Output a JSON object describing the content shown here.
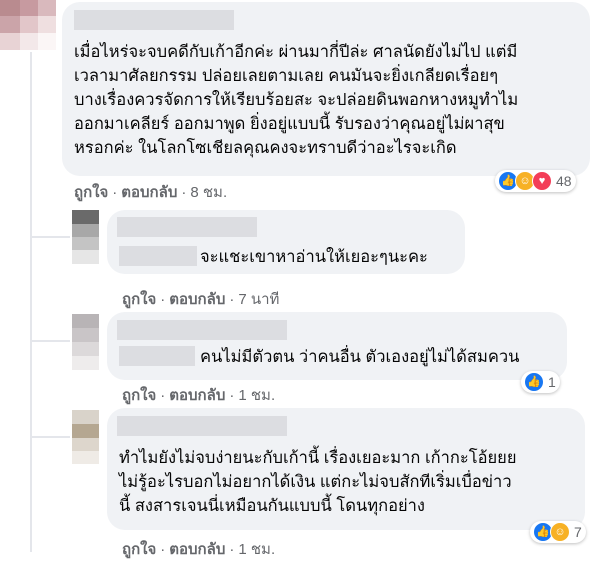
{
  "comments": [
    {
      "text": "เมื่อไหร่จะจบคดีกับเก้าอีกค่ะ ผ่านมากี่ปีล่ะ ศาลนัดยังไม่ไป แต่มี\nเวลามาศัลยกรรม ปล่อยเลยตามเลย คนมันจะยิ่งเกลียดเรื่อยๆ\nบางเรื่องควรจัดการให้เรียบร้อยสะ จะปล่อยดินพอกหางหมูทำไม\nออกมาเคลียร์ ออกมาพูด ยิ่งอยู่แบบนี้ รับรองว่าคุณอยู่ไม่ผาสุข\nหรอกค่ะ ในโลกโซเชียลคุณคงจะทราบดีว่าอะไรจะเกิด",
      "like": "ถูกใจ",
      "reply": "ตอบกลับ",
      "time": "8 ชม.",
      "reaction_count": "48",
      "reactions": [
        "like-icon",
        "haha-icon",
        "love-icon"
      ]
    },
    {
      "text": "จะแชะเขาหาอ่านให้เยอะๆนะคะ",
      "like": "ถูกใจ",
      "reply": "ตอบกลับ",
      "time": "7 นาที"
    },
    {
      "text": "คนไม่มีตัวตน ว่าคนอื่น ตัวเองอยู่ไม่ได้สมควน",
      "like": "ถูกใจ",
      "reply": "ตอบกลับ",
      "time": "1 ชม.",
      "reaction_count": "1",
      "reactions": [
        "like-icon"
      ]
    },
    {
      "text": "ทำไมยังไม่จบง่ายนะกับเก้านี้ เรื่องเยอะมาก เก้ากะโอ้ยยย\nไม่รู้อะไรบอกไม่อยากได้เงิน แต่กะไม่จบสักทีเริ่มเบื่อข่าว\nนี้ สงสารเจนนี่เหมือนกันแบบนี้ โดนทุกอย่าง",
      "like": "ถูกใจ",
      "reply": "ตอบกลับ",
      "time": "1 ชม.",
      "reaction_count": "7",
      "reactions": [
        "like-icon",
        "haha-icon"
      ]
    }
  ],
  "separator": "·"
}
